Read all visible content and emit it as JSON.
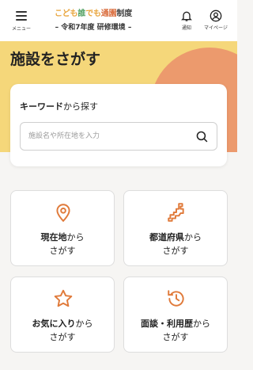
{
  "header": {
    "menu_label": "メニュー",
    "logo_text": {
      "part1": "こども",
      "part2": "誰",
      "part3": "でも",
      "part4": "通園",
      "part5": "制度"
    },
    "subtitle": "– 令和7年度 研修環境 –",
    "notify_label": "通知",
    "mypage_label": "マイページ"
  },
  "hero": {
    "title": "施設をさがす",
    "colors": {
      "yellow": "#f5d77a",
      "orange": "#ec9a6d"
    }
  },
  "search": {
    "heading_bold": "キーワード",
    "heading_rest": "から探す",
    "placeholder": "施設名や所在地を入力",
    "icon": "search-icon"
  },
  "tiles": [
    {
      "icon": "location-pin-icon",
      "bold": "現在地",
      "rest": "から",
      "line2": "さがす"
    },
    {
      "icon": "map-region-icon",
      "bold": "都道府県",
      "rest": "から",
      "line2": "さがす"
    },
    {
      "icon": "star-icon",
      "bold": "お気に入り",
      "rest": "から",
      "line2": "さがす"
    },
    {
      "icon": "history-icon",
      "bold": "面談・利用歴",
      "rest": "から",
      "line2": "さがす"
    }
  ],
  "accent_color": "#e07a3a"
}
